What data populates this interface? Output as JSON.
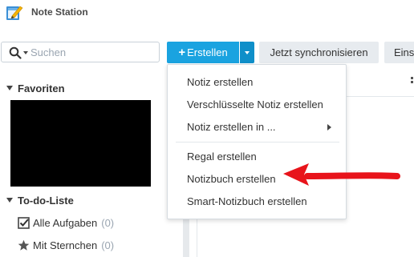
{
  "app": {
    "title": "Note Station",
    "icon": "note-station-app-icon"
  },
  "toolbar": {
    "search": {
      "placeholder": "Suchen",
      "value": ""
    },
    "create_label": "Erstellen",
    "create_plus": "+",
    "sync_label": "Jetzt synchronisieren",
    "more_label": "Einst"
  },
  "sidebar": {
    "favorites_label": "Favoriten",
    "todo_label": "To-do-Liste",
    "todo_items": [
      {
        "label": "Alle Aufgaben",
        "count": "(0)",
        "icon": "checkbox-icon"
      },
      {
        "label": "Mit Sternchen",
        "count": "(0)",
        "icon": "star-icon"
      }
    ]
  },
  "create_menu": {
    "items": [
      {
        "label": "Notiz erstellen"
      },
      {
        "label": "Verschlüsselte Notiz erstellen"
      },
      {
        "label": "Notiz erstellen in ...",
        "has_submenu": true
      },
      {
        "label": "Regal erstellen"
      },
      {
        "label": "Notizbuch erstellen",
        "highlighted_by_arrow": true
      },
      {
        "label": "Smart-Notizbuch erstellen"
      }
    ]
  },
  "colors": {
    "accent": "#1aa3e0",
    "accent_dark": "#0f8fc9",
    "annotation_arrow": "#e8141b",
    "button_gray": "#e7ebef"
  }
}
